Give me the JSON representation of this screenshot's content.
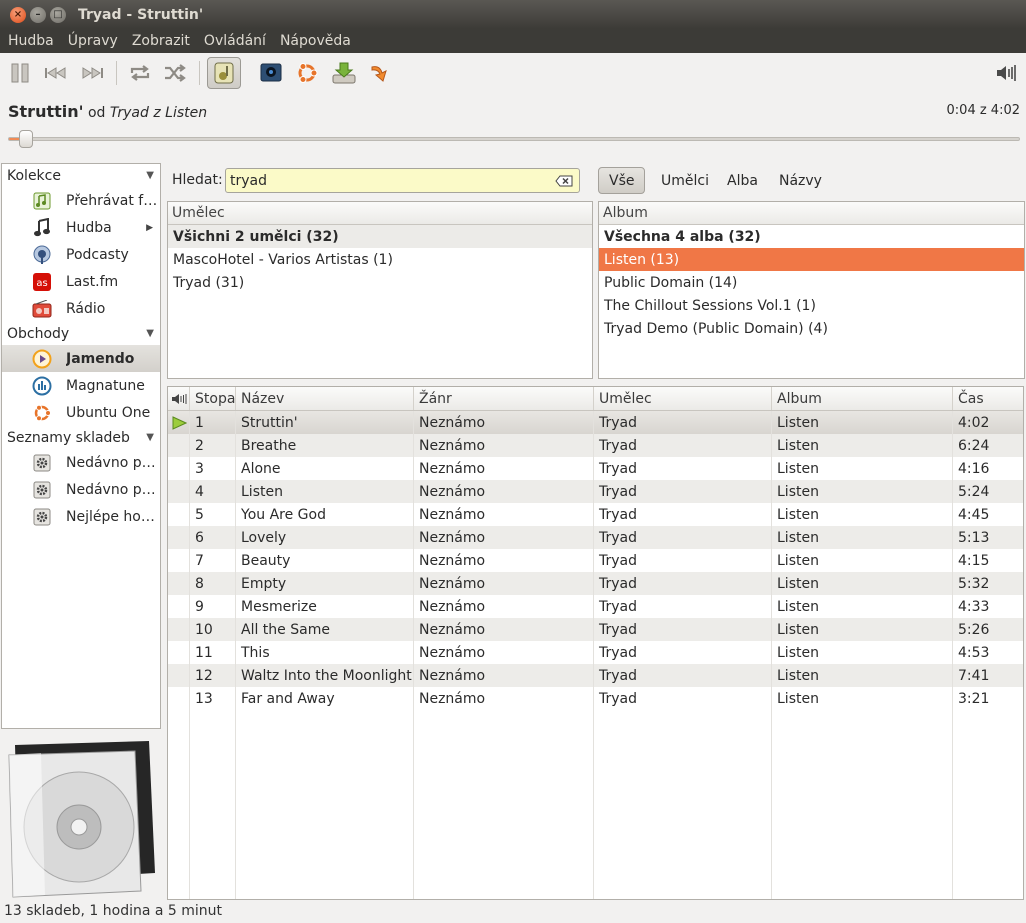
{
  "window": {
    "title": "Tryad - Struttin'"
  },
  "menu": [
    "Hudba",
    "Úpravy",
    "Zobrazit",
    "Ovládání",
    "Nápověda"
  ],
  "now_playing": {
    "track": "Struttin'",
    "by_word": "od",
    "artist": "Tryad",
    "from_word": "z",
    "album": "Listen",
    "time": "0:04 z 4:02",
    "progress": 0.017
  },
  "sidebar": {
    "sections": [
      {
        "title": "Kolekce",
        "items": [
          {
            "label": "Přehrávat fronta",
            "icon": "play-queue-icon"
          },
          {
            "label": "Hudba",
            "icon": "music-note-icon"
          },
          {
            "label": "Podcasty",
            "icon": "podcast-icon"
          },
          {
            "label": "Last.fm",
            "icon": "lastfm-icon"
          },
          {
            "label": "Rádio",
            "icon": "radio-icon"
          }
        ]
      },
      {
        "title": "Obchody",
        "items": [
          {
            "label": "Jamendo",
            "icon": "jamendo-icon",
            "selected": true
          },
          {
            "label": "Magnatune",
            "icon": "magnatune-icon"
          },
          {
            "label": "Ubuntu One",
            "icon": "ubuntu-one-icon"
          }
        ]
      },
      {
        "title": "Seznamy skladeb",
        "items": [
          {
            "label": "Nedávno přidané",
            "icon": "gear-icon"
          },
          {
            "label": "Nedávno přehrávané",
            "icon": "gear-icon"
          },
          {
            "label": "Nejlépe hodnocené",
            "icon": "gear-icon"
          }
        ]
      }
    ]
  },
  "search": {
    "label": "Hledat:",
    "value": "tryad"
  },
  "filters": [
    "Vše",
    "Umělci",
    "Alba",
    "Názvy"
  ],
  "artist_pane": {
    "header": "Umělec",
    "rows": [
      "Všichni 2 umělci (32)",
      "MascoHotel - Varios Artistas (1)",
      "Tryad (31)"
    ]
  },
  "album_pane": {
    "header": "Album",
    "rows": [
      "Všechna 4 alba (32)",
      "Listen (13)",
      "Public Domain (14)",
      "The Chillout Sessions Vol.1 (1)",
      "Tryad Demo (Public Domain) (4)"
    ]
  },
  "tracks": {
    "columns": [
      "Stopa",
      "Název",
      "Žánr",
      "Umělec",
      "Album",
      "Čas"
    ],
    "rows": [
      [
        "1",
        "Struttin'",
        "Neznámo",
        "Tryad",
        "Listen",
        "4:02"
      ],
      [
        "2",
        "Breathe",
        "Neznámo",
        "Tryad",
        "Listen",
        "6:24"
      ],
      [
        "3",
        "Alone",
        "Neznámo",
        "Tryad",
        "Listen",
        "4:16"
      ],
      [
        "4",
        "Listen",
        "Neznámo",
        "Tryad",
        "Listen",
        "5:24"
      ],
      [
        "5",
        "You Are God",
        "Neznámo",
        "Tryad",
        "Listen",
        "4:45"
      ],
      [
        "6",
        "Lovely",
        "Neznámo",
        "Tryad",
        "Listen",
        "5:13"
      ],
      [
        "7",
        "Beauty",
        "Neznámo",
        "Tryad",
        "Listen",
        "4:15"
      ],
      [
        "8",
        "Empty",
        "Neznámo",
        "Tryad",
        "Listen",
        "5:32"
      ],
      [
        "9",
        "Mesmerize",
        "Neznámo",
        "Tryad",
        "Listen",
        "4:33"
      ],
      [
        "10",
        "All the Same",
        "Neznámo",
        "Tryad",
        "Listen",
        "5:26"
      ],
      [
        "11",
        "This",
        "Neznámo",
        "Tryad",
        "Listen",
        "4:53"
      ],
      [
        "12",
        "Waltz Into the Moonlight",
        "Neznámo",
        "Tryad",
        "Listen",
        "7:41"
      ],
      [
        "13",
        "Far and Away",
        "Neznámo",
        "Tryad",
        "Listen",
        "3:21"
      ]
    ]
  },
  "status": "13 skladeb, 1 hodina a 5 minut",
  "colors": {
    "accent": "#f07746",
    "titlebar": "#3c3b37",
    "search_bg": "#fbfac8"
  }
}
